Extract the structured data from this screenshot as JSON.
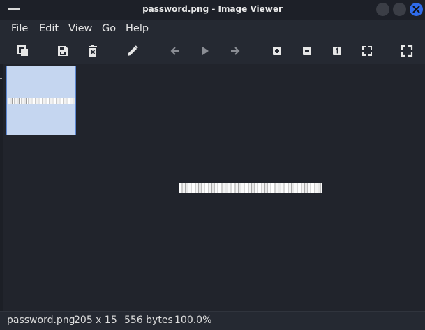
{
  "window": {
    "title": "password.png - Image Viewer"
  },
  "menubar": {
    "items": [
      "File",
      "Edit",
      "View",
      "Go",
      "Help"
    ]
  },
  "toolbar": {
    "icons": [
      "copy-icon",
      "save-icon",
      "delete-icon",
      "edit-icon",
      "back-icon",
      "play-icon",
      "forward-icon",
      "zoom-in-icon",
      "zoom-out-icon",
      "zoom-actual-icon",
      "zoom-fit-icon",
      "fullscreen-icon"
    ]
  },
  "status": {
    "filename": "password.png",
    "dimensions": "205 x 15",
    "size": "556 bytes",
    "zoom": "100.0%"
  },
  "colors": {
    "accent": "#2f6bea",
    "thumb_bg": "#c5d6f0",
    "background": "#21242c"
  }
}
